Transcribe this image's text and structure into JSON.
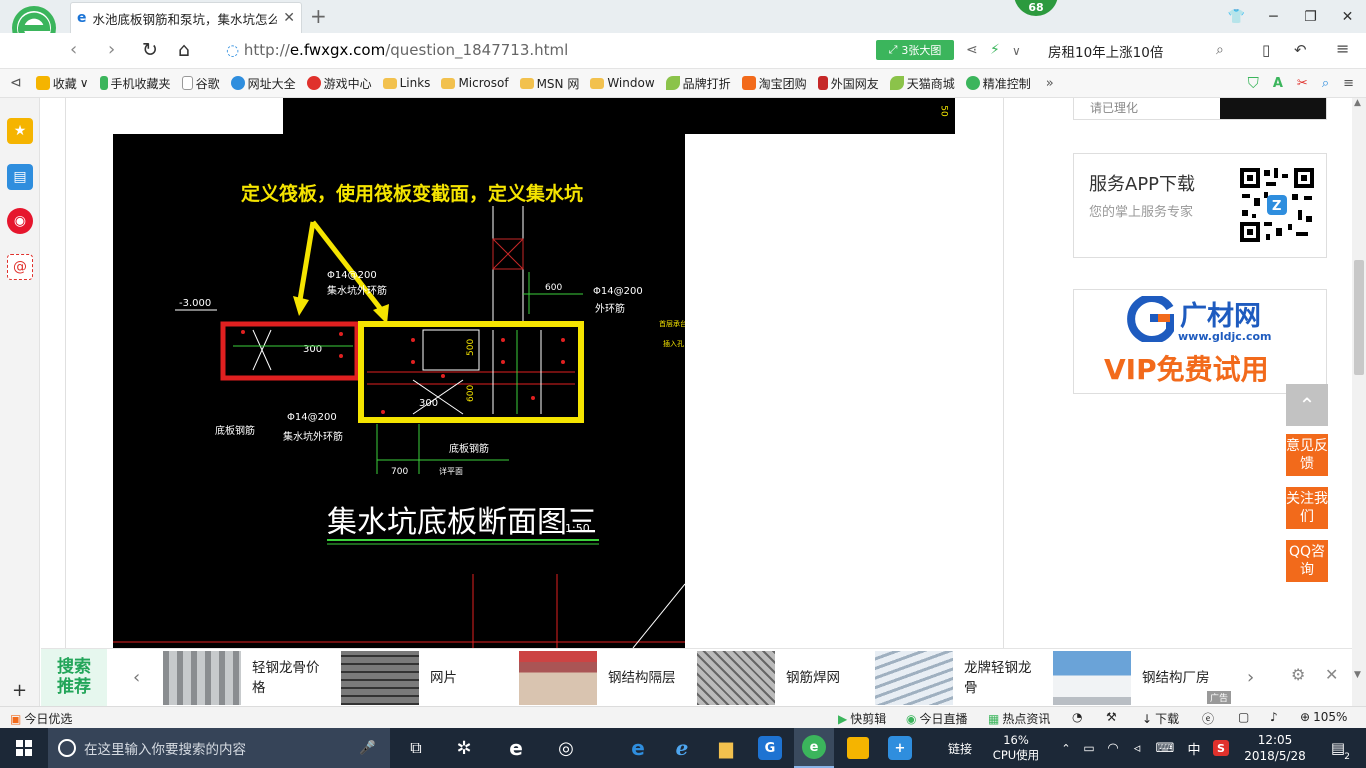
{
  "browser": {
    "tab_title": "水池底板钢筋和泵坑，集水坑怎么",
    "new_tab": "+",
    "badge_count": "68",
    "url_prefix": "http://",
    "url_domain": "e.fwxgx.com",
    "url_path": "/question_1847713.html",
    "big_image_label": "3张大图",
    "search_text": "房租10年上涨10倍",
    "zoom": "105%"
  },
  "bookmarks": [
    {
      "label": "收藏",
      "color": "#f5b400"
    },
    {
      "label": "手机收藏夹",
      "color": "#3bb55c"
    },
    {
      "label": "谷歌",
      "color": "#9aa3ad"
    },
    {
      "label": "网址大全",
      "color": "#2f8ede"
    },
    {
      "label": "游戏中心",
      "color": "#e0312c"
    },
    {
      "label": "Links",
      "color": "#f2c14e"
    },
    {
      "label": "Microsof",
      "color": "#f2c14e"
    },
    {
      "label": "MSN 网",
      "color": "#f2c14e"
    },
    {
      "label": "Window",
      "color": "#f2c14e"
    },
    {
      "label": "品牌打折",
      "color": "#8bc34a"
    },
    {
      "label": "淘宝团购",
      "color": "#f26a1b"
    },
    {
      "label": "外国网友",
      "color": "#c62828"
    },
    {
      "label": "天猫商城",
      "color": "#8bc34a"
    },
    {
      "label": "精准控制",
      "color": "#3bb55c"
    }
  ],
  "drawing": {
    "annotation": "定义筏板，使用筏板变截面，定义集水坑",
    "title": "集水坑底板断面图三",
    "scale": "1:50",
    "elev": "-3.000",
    "rebar1": "Φ14@200",
    "rebar1_sub": "集水坑外环筋",
    "rebar2": "Φ14@200",
    "rebar2_sub": "外环筋",
    "rebar3": "Φ14@200",
    "rebar3_sub": "集水坑外环筋",
    "floor_rebar_left": "底板钢筋",
    "floor_rebar_mid": "底板钢筋",
    "dim_300a": "300",
    "dim_300b": "300",
    "dim_500": "500",
    "dim_600a": "600",
    "dim_600b": "600",
    "dim_700": "700",
    "dim_detail": "详平面",
    "note1": "首层承台",
    "note2": "插入孔",
    "corner_num": "50"
  },
  "right_panel": {
    "card_top_text": "请已理化",
    "app_title": "服务APP下载",
    "app_sub": "您的掌上服务专家",
    "gl_brand": "广材网",
    "gl_url": "www.gldjc.com",
    "gl_vip": "VIP免费试用",
    "btn_feedback": "意见反馈",
    "btn_follow": "关注我们",
    "btn_qq": "QQ咨询"
  },
  "recommend": {
    "label": "搜索推荐",
    "items": [
      {
        "label": "轻钢龙骨价格"
      },
      {
        "label": "网片"
      },
      {
        "label": "钢结构隔层"
      },
      {
        "label": "钢筋焊网"
      },
      {
        "label": "龙牌轻钢龙骨"
      },
      {
        "label": "钢结构厂房"
      }
    ],
    "ad": "广告"
  },
  "statusbar": {
    "left": "今日优选",
    "kuai": "快剪辑",
    "live": "今日直播",
    "news": "热点资讯",
    "download": "下载",
    "zoom": "105%"
  },
  "taskbar": {
    "search_placeholder": "在这里输入你要搜索的内容",
    "links": "链接",
    "cpu": "16%",
    "cpu_label": "CPU使用",
    "ime": "中",
    "time": "12:05",
    "date": "2018/5/28",
    "notif_count": "2"
  }
}
